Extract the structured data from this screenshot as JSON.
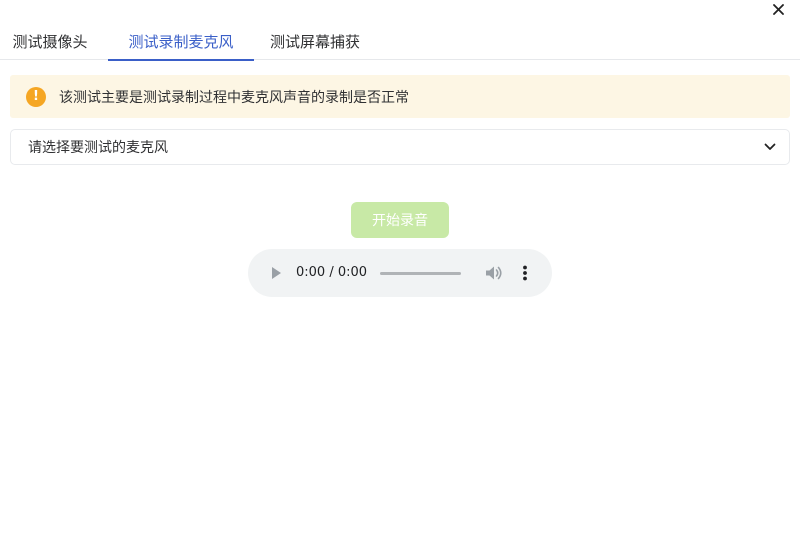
{
  "dialog": {
    "close_icon": "close-icon"
  },
  "tabs": [
    {
      "label": "测试摄像头",
      "active": false
    },
    {
      "label": "测试录制麦克风",
      "active": true
    },
    {
      "label": "测试屏幕捕获",
      "active": false
    }
  ],
  "alert": {
    "icon": "warning-icon",
    "icon_glyph": "!",
    "text": "该测试主要是测试录制过程中麦克风声音的录制是否正常"
  },
  "microphone_select": {
    "value": "请选择要测试的麦克风",
    "icon": "chevron-down-icon"
  },
  "record_button": {
    "label": "开始录音",
    "disabled": true
  },
  "audio_player": {
    "time": "0:00 / 0:00",
    "progress": 0,
    "icons": [
      "play-icon",
      "volume-icon",
      "more-icon"
    ]
  },
  "colors": {
    "accent": "#3a5fc8",
    "alert_background": "#fdf6e4",
    "alert_icon": "#f5a623",
    "record_button_disabled": "#c8e9a6",
    "audio_background": "#f1f3f4"
  }
}
